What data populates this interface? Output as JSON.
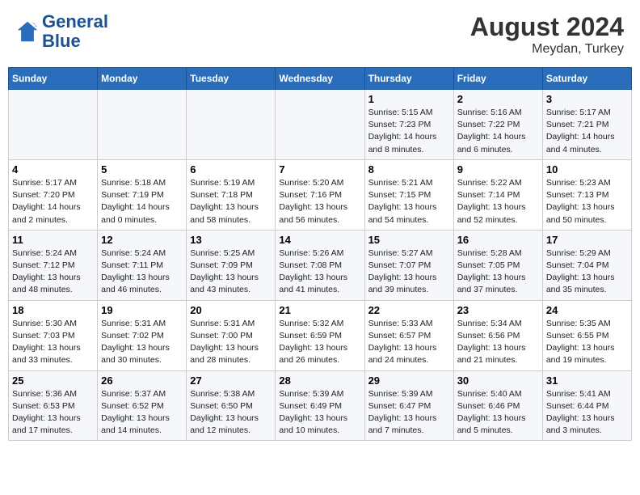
{
  "header": {
    "logo_line1": "General",
    "logo_line2": "Blue",
    "month_year": "August 2024",
    "location": "Meydan, Turkey"
  },
  "weekdays": [
    "Sunday",
    "Monday",
    "Tuesday",
    "Wednesday",
    "Thursday",
    "Friday",
    "Saturday"
  ],
  "weeks": [
    [
      {
        "day": "",
        "info": ""
      },
      {
        "day": "",
        "info": ""
      },
      {
        "day": "",
        "info": ""
      },
      {
        "day": "",
        "info": ""
      },
      {
        "day": "1",
        "info": "Sunrise: 5:15 AM\nSunset: 7:23 PM\nDaylight: 14 hours\nand 8 minutes."
      },
      {
        "day": "2",
        "info": "Sunrise: 5:16 AM\nSunset: 7:22 PM\nDaylight: 14 hours\nand 6 minutes."
      },
      {
        "day": "3",
        "info": "Sunrise: 5:17 AM\nSunset: 7:21 PM\nDaylight: 14 hours\nand 4 minutes."
      }
    ],
    [
      {
        "day": "4",
        "info": "Sunrise: 5:17 AM\nSunset: 7:20 PM\nDaylight: 14 hours\nand 2 minutes."
      },
      {
        "day": "5",
        "info": "Sunrise: 5:18 AM\nSunset: 7:19 PM\nDaylight: 14 hours\nand 0 minutes."
      },
      {
        "day": "6",
        "info": "Sunrise: 5:19 AM\nSunset: 7:18 PM\nDaylight: 13 hours\nand 58 minutes."
      },
      {
        "day": "7",
        "info": "Sunrise: 5:20 AM\nSunset: 7:16 PM\nDaylight: 13 hours\nand 56 minutes."
      },
      {
        "day": "8",
        "info": "Sunrise: 5:21 AM\nSunset: 7:15 PM\nDaylight: 13 hours\nand 54 minutes."
      },
      {
        "day": "9",
        "info": "Sunrise: 5:22 AM\nSunset: 7:14 PM\nDaylight: 13 hours\nand 52 minutes."
      },
      {
        "day": "10",
        "info": "Sunrise: 5:23 AM\nSunset: 7:13 PM\nDaylight: 13 hours\nand 50 minutes."
      }
    ],
    [
      {
        "day": "11",
        "info": "Sunrise: 5:24 AM\nSunset: 7:12 PM\nDaylight: 13 hours\nand 48 minutes."
      },
      {
        "day": "12",
        "info": "Sunrise: 5:24 AM\nSunset: 7:11 PM\nDaylight: 13 hours\nand 46 minutes."
      },
      {
        "day": "13",
        "info": "Sunrise: 5:25 AM\nSunset: 7:09 PM\nDaylight: 13 hours\nand 43 minutes."
      },
      {
        "day": "14",
        "info": "Sunrise: 5:26 AM\nSunset: 7:08 PM\nDaylight: 13 hours\nand 41 minutes."
      },
      {
        "day": "15",
        "info": "Sunrise: 5:27 AM\nSunset: 7:07 PM\nDaylight: 13 hours\nand 39 minutes."
      },
      {
        "day": "16",
        "info": "Sunrise: 5:28 AM\nSunset: 7:05 PM\nDaylight: 13 hours\nand 37 minutes."
      },
      {
        "day": "17",
        "info": "Sunrise: 5:29 AM\nSunset: 7:04 PM\nDaylight: 13 hours\nand 35 minutes."
      }
    ],
    [
      {
        "day": "18",
        "info": "Sunrise: 5:30 AM\nSunset: 7:03 PM\nDaylight: 13 hours\nand 33 minutes."
      },
      {
        "day": "19",
        "info": "Sunrise: 5:31 AM\nSunset: 7:02 PM\nDaylight: 13 hours\nand 30 minutes."
      },
      {
        "day": "20",
        "info": "Sunrise: 5:31 AM\nSunset: 7:00 PM\nDaylight: 13 hours\nand 28 minutes."
      },
      {
        "day": "21",
        "info": "Sunrise: 5:32 AM\nSunset: 6:59 PM\nDaylight: 13 hours\nand 26 minutes."
      },
      {
        "day": "22",
        "info": "Sunrise: 5:33 AM\nSunset: 6:57 PM\nDaylight: 13 hours\nand 24 minutes."
      },
      {
        "day": "23",
        "info": "Sunrise: 5:34 AM\nSunset: 6:56 PM\nDaylight: 13 hours\nand 21 minutes."
      },
      {
        "day": "24",
        "info": "Sunrise: 5:35 AM\nSunset: 6:55 PM\nDaylight: 13 hours\nand 19 minutes."
      }
    ],
    [
      {
        "day": "25",
        "info": "Sunrise: 5:36 AM\nSunset: 6:53 PM\nDaylight: 13 hours\nand 17 minutes."
      },
      {
        "day": "26",
        "info": "Sunrise: 5:37 AM\nSunset: 6:52 PM\nDaylight: 13 hours\nand 14 minutes."
      },
      {
        "day": "27",
        "info": "Sunrise: 5:38 AM\nSunset: 6:50 PM\nDaylight: 13 hours\nand 12 minutes."
      },
      {
        "day": "28",
        "info": "Sunrise: 5:39 AM\nSunset: 6:49 PM\nDaylight: 13 hours\nand 10 minutes."
      },
      {
        "day": "29",
        "info": "Sunrise: 5:39 AM\nSunset: 6:47 PM\nDaylight: 13 hours\nand 7 minutes."
      },
      {
        "day": "30",
        "info": "Sunrise: 5:40 AM\nSunset: 6:46 PM\nDaylight: 13 hours\nand 5 minutes."
      },
      {
        "day": "31",
        "info": "Sunrise: 5:41 AM\nSunset: 6:44 PM\nDaylight: 13 hours\nand 3 minutes."
      }
    ]
  ]
}
